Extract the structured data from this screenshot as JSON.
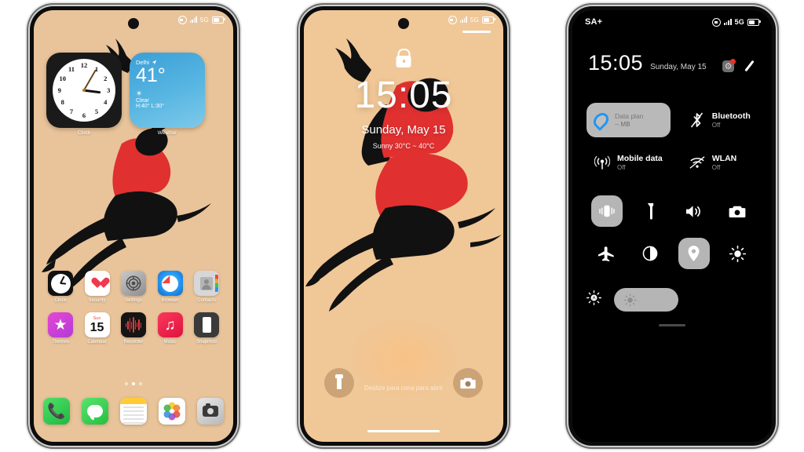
{
  "home": {
    "status_bar": {
      "mute_icon": "mute-icon",
      "signal_icon": "signal-icon",
      "network": "5G",
      "battery_icon": "battery-icon"
    },
    "widgets": [
      {
        "name": "clock",
        "label": "Clock",
        "time_hour": 3,
        "time_minute": 5
      },
      {
        "name": "weather",
        "label": "Weather",
        "city": "Delhi",
        "location_icon": "location-arrow-icon",
        "temperature": "41°",
        "condition": "Clear",
        "high_low": "H:40° L:30°",
        "sun_icon": "sun-icon"
      }
    ],
    "apps_row1": [
      {
        "label": "Clock",
        "icon": "clock-app-icon"
      },
      {
        "label": "Security",
        "icon": "heart-shield-icon"
      },
      {
        "label": "Settings",
        "icon": "gear-icon"
      },
      {
        "label": "Browser",
        "icon": "compass-icon"
      },
      {
        "label": "Contacts",
        "icon": "contacts-icon"
      }
    ],
    "apps_row2": [
      {
        "label": "Themes",
        "icon": "star-icon"
      },
      {
        "label": "Calendar",
        "icon": "calendar-icon",
        "day_name": "Sun",
        "day_number": "15"
      },
      {
        "label": "Recorder",
        "icon": "waveform-icon"
      },
      {
        "label": "Music",
        "icon": "music-note-icon"
      },
      {
        "label": "Snapmod",
        "icon": "phone-mockup-icon"
      }
    ],
    "page_dots": {
      "count": 3,
      "active_index": 1
    },
    "dock": [
      {
        "label": "Phone",
        "icon": "phone-handset-icon"
      },
      {
        "label": "Messages",
        "icon": "speech-bubble-icon"
      },
      {
        "label": "Notes",
        "icon": "notes-icon"
      },
      {
        "label": "Photos",
        "icon": "photos-flower-icon"
      },
      {
        "label": "Camera",
        "icon": "camera-icon"
      }
    ]
  },
  "lock": {
    "status_bar": {
      "mute_icon": "mute-icon",
      "signal_icon": "signal-icon",
      "network": "5G",
      "battery_icon": "battery-icon"
    },
    "lock_icon": "lock-icon",
    "time": "15:05",
    "date": "Sunday, May 15",
    "weather": "Sunny  30°C ~ 40°C",
    "hint": "Deslize para cima para abrir",
    "left_button": {
      "icon": "flashlight-icon"
    },
    "right_button": {
      "icon": "camera-icon"
    }
  },
  "control_center": {
    "status_bar": {
      "carrier": "SA+",
      "mute_icon": "mute-icon",
      "signal_icon": "signal-icon",
      "network": "5G",
      "battery_icon": "battery-icon"
    },
    "time": "15:05",
    "date": "Sunday, May 15",
    "header_icons": [
      {
        "name": "settings-gear-icon",
        "badge": true
      },
      {
        "name": "edit-pencil-icon",
        "badge": false
      }
    ],
    "tiles": [
      {
        "title": "Data plan",
        "subtitle": "-- MB",
        "icon": "water-drop-icon",
        "active": true
      },
      {
        "title": "Bluetooth",
        "subtitle": "Off",
        "icon": "bluetooth-off-icon",
        "active": false
      },
      {
        "title": "Mobile data",
        "subtitle": "Off",
        "icon": "mobile-data-icon",
        "active": false
      },
      {
        "title": "WLAN",
        "subtitle": "Off",
        "icon": "wlan-off-icon",
        "active": false
      }
    ],
    "quick_buttons": [
      {
        "name": "vibrate-icon",
        "active": true
      },
      {
        "name": "flashlight-icon",
        "active": false
      },
      {
        "name": "sound-icon",
        "active": false
      },
      {
        "name": "camera-icon",
        "active": false
      },
      {
        "name": "airplane-mode-icon",
        "active": false
      },
      {
        "name": "dark-mode-icon",
        "active": false
      },
      {
        "name": "location-icon",
        "active": true
      },
      {
        "name": "brightness-icon",
        "active": false
      }
    ],
    "brightness": {
      "auto_icon": "auto-brightness-icon",
      "slider_icon": "brightness-sun-icon",
      "value": 55
    }
  },
  "colors": {
    "wallpaper": "#e9c49a",
    "wallpaper_lock": "#f0c797",
    "shirt_red": "#e03030",
    "figure_black": "#111111",
    "weather_blue": "#3b9fd6",
    "accent_red": "#e63329",
    "cc_background": "#000000",
    "tile_active": "#b9b9b9"
  }
}
